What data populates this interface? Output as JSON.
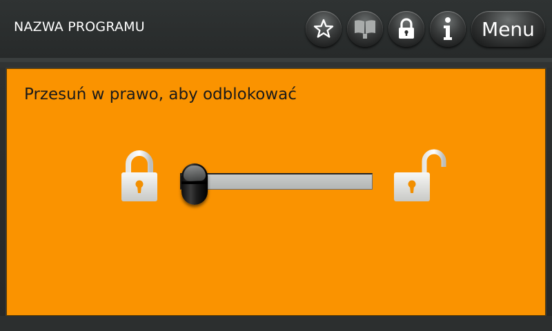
{
  "app": {
    "title": "NAZWA PROGRAMU"
  },
  "toolbar": {
    "buttons": [
      {
        "icon": "star-icon"
      },
      {
        "icon": "book-icon"
      },
      {
        "icon": "lock-icon"
      },
      {
        "icon": "info-icon"
      }
    ],
    "menu_label": "Menu"
  },
  "unlock_panel": {
    "instruction": "Przesuń w prawo, aby odblokować",
    "left_icon": "locked-padlock-icon",
    "right_icon": "unlocked-padlock-icon",
    "slider_value": 0
  },
  "colors": {
    "panel_background": "#fa9300",
    "toolbar_background": "#2f3232",
    "track": "#c0c2c1",
    "knob": "#1a1a1a"
  }
}
